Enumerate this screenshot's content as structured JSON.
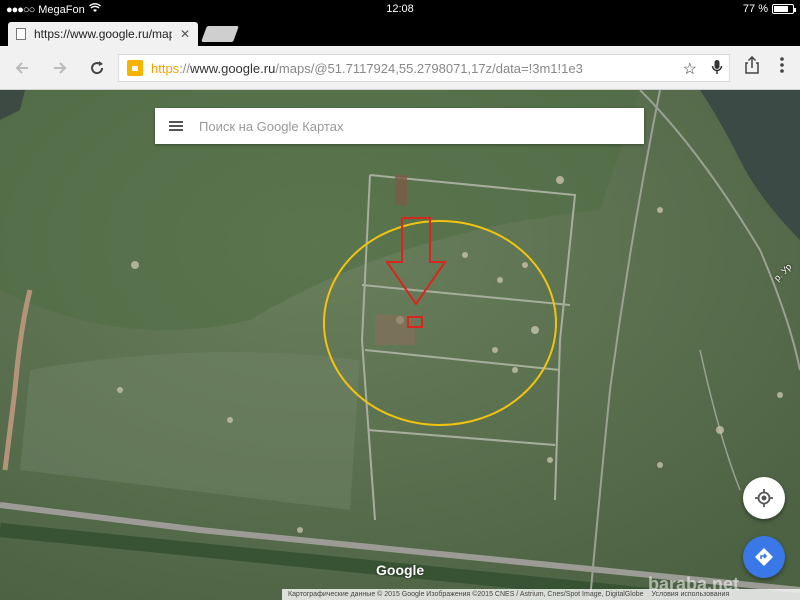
{
  "status": {
    "carrier": "MegaFon",
    "time": "12:08",
    "battery_text": "77 %",
    "battery_level": 0.77
  },
  "tabs": {
    "active_title": "https://www.google.ru/map",
    "close_glyph": "✕"
  },
  "toolbar": {
    "url_scheme": "https",
    "url_sep": "://",
    "url_domain": "www.google.ru",
    "url_path": "/maps/@51.7117924,55.2798071,17z/data=!3m1!1e3",
    "icons": [
      "back-arrow-icon",
      "forward-arrow-icon",
      "reload-icon",
      "lock-icon",
      "star-icon",
      "mic-icon",
      "share-icon",
      "menu-icon"
    ]
  },
  "search": {
    "placeholder": "Поиск на Google Картах"
  },
  "map": {
    "river_label": "р. Ур",
    "logo": "Google",
    "attribution_left": "Картографические данные © 2015 Google Изображения ©2015 CNES / Astrium, Cnes/Spot Image, DigitalGlobe",
    "attribution_right": "Условия использования",
    "watermark": "baraba.net",
    "colors": {
      "highlight_circle": "#f2c40f",
      "arrow": "#d9261c",
      "fab_directions": "#3b78e7"
    }
  }
}
